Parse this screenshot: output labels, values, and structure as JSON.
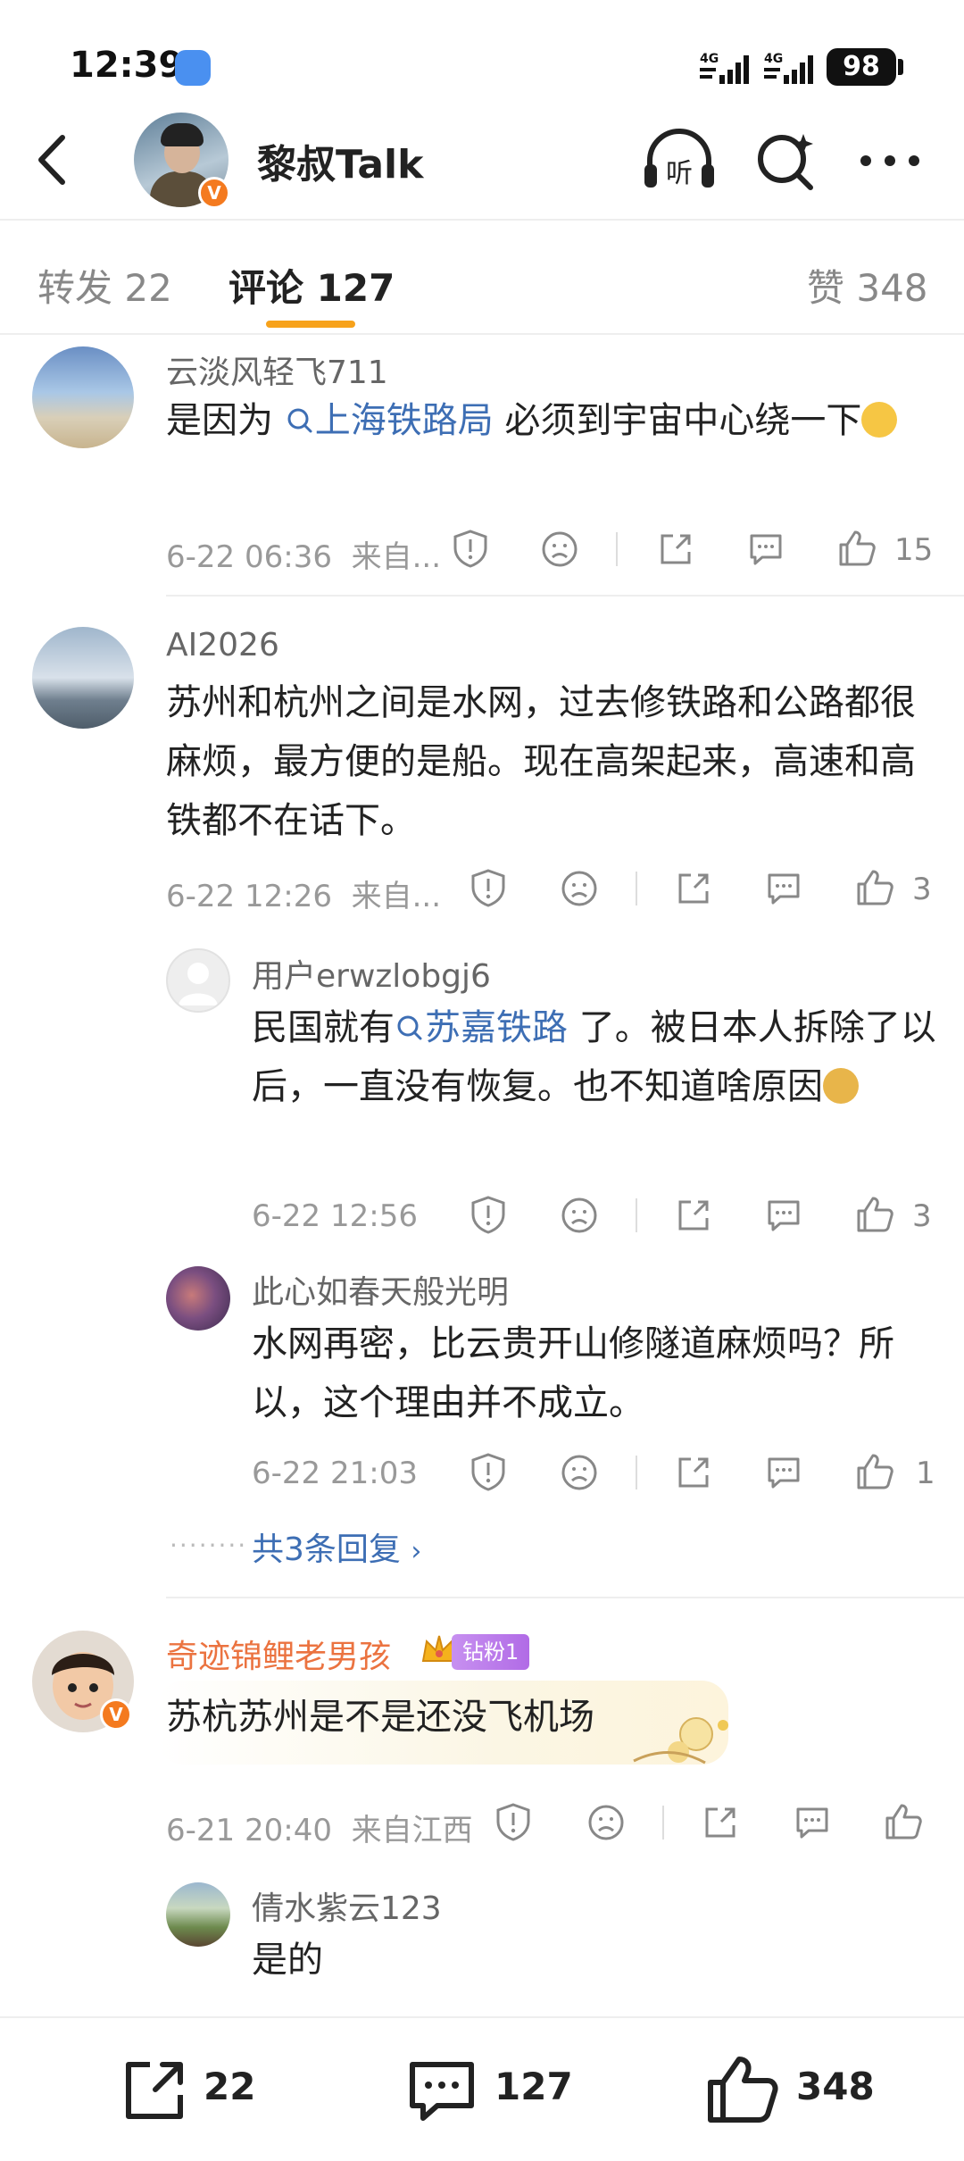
{
  "status_bar": {
    "time": "12:39",
    "network1": "4G",
    "network2": "4G",
    "battery": "98"
  },
  "header": {
    "title": "黎叔Talk",
    "verified_badge": "V",
    "listen_label": "听"
  },
  "tabs": [
    {
      "label": "转发 22",
      "active": false
    },
    {
      "label": "评论 127",
      "active": true
    },
    {
      "label": "赞 348",
      "active": false
    }
  ],
  "comments": [
    {
      "user": "云淡风轻飞711",
      "text_before": "是因为",
      "topic": "上海铁路局",
      "text_after": " 必须到宇宙中心绕一下",
      "time": "6-22 06:36",
      "source": "来自...",
      "likes": "15"
    },
    {
      "user": "AI2026",
      "text": "苏州和杭州之间是水网，过去修铁路和公路都很麻烦，最方便的是船。现在高架起来，高速和高铁都不在话下。",
      "time": "6-22 12:26",
      "source": "来自...",
      "likes": "3",
      "replies": [
        {
          "user": "用户erwzlobgj6",
          "text_before": "民国就有",
          "topic": "苏嘉铁路",
          "text_after": " 了。被日本人拆除了以后，一直没有恢复。也不知道啥原因",
          "time": "6-22 12:56",
          "likes": "3"
        },
        {
          "user": "此心如春天般光明",
          "text": "水网再密，比云贵开山修隧道麻烦吗？所以，这个理由并不成立。",
          "time": "6-22 21:03",
          "likes": "1"
        }
      ],
      "more_replies": "共3条回复"
    },
    {
      "user": "奇迹锦鲤老男孩",
      "fan_badge": "钻粉1",
      "text": "苏杭苏州是不是还没飞机场",
      "time": "6-21 20:40",
      "source": "来自江西",
      "replies": [
        {
          "user": "倩水紫云123",
          "text": "是的"
        }
      ]
    }
  ],
  "bottom_bar": {
    "reposts": "22",
    "comments": "127",
    "likes": "348"
  },
  "colors": {
    "accent": "#f7a21b",
    "link": "#3d6eb4",
    "vip_name": "#eb7340"
  }
}
